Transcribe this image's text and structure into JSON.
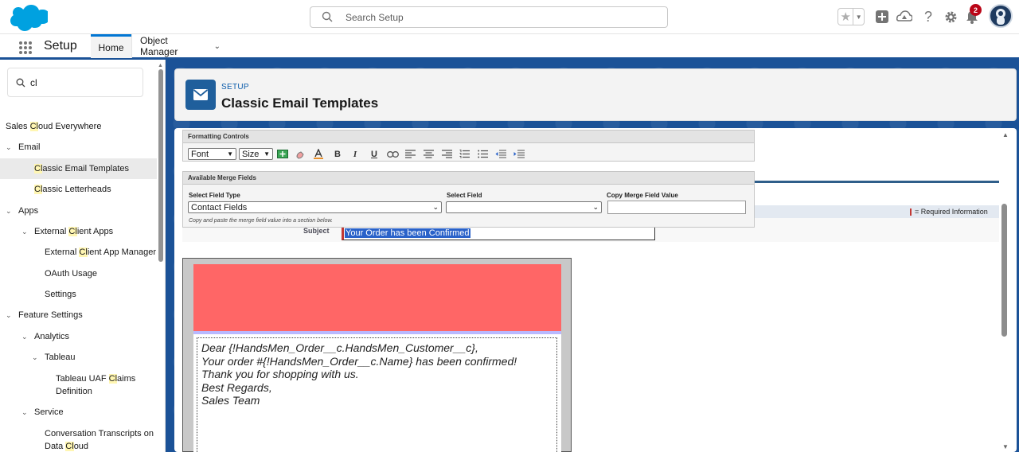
{
  "header": {
    "search_placeholder": "Search Setup",
    "notification_count": "2"
  },
  "appnav": {
    "app_name": "Setup",
    "tabs": [
      {
        "label": "Home"
      },
      {
        "label": "Object Manager"
      }
    ]
  },
  "sidebar": {
    "quick_find_value": "cl",
    "items": [
      {
        "pre": "Sales ",
        "hl": "Cl",
        "post": "oud Everywhere"
      },
      {
        "pre": "Email",
        "hl": "",
        "post": ""
      },
      {
        "pre": "",
        "hl": "Cl",
        "post": "assic Email Templates"
      },
      {
        "pre": "",
        "hl": "Cl",
        "post": "assic Letterheads"
      },
      {
        "pre": "Apps",
        "hl": "",
        "post": ""
      },
      {
        "pre": "External ",
        "hl": "Cl",
        "post": "ient Apps"
      },
      {
        "pre": "External ",
        "hl": "Cl",
        "post": "ient App Manager"
      },
      {
        "pre": "OAuth Usage",
        "hl": "",
        "post": ""
      },
      {
        "pre": "Settings",
        "hl": "",
        "post": ""
      },
      {
        "pre": "Feature Settings",
        "hl": "",
        "post": ""
      },
      {
        "pre": "Analytics",
        "hl": "",
        "post": ""
      },
      {
        "pre": "Tableau",
        "hl": "",
        "post": ""
      },
      {
        "pre": "Tableau UAF ",
        "hl": "Cl",
        "post": "aims"
      },
      {
        "pre": "Definition",
        "hl": "",
        "post": ""
      },
      {
        "pre": "Service",
        "hl": "",
        "post": ""
      },
      {
        "pre": "Conversation Transcripts on",
        "hl": "",
        "post": ""
      },
      {
        "pre": "Data ",
        "hl": "Cl",
        "post": "oud"
      }
    ]
  },
  "page_header": {
    "eyebrow": "SETUP",
    "title": "Classic Email Templates"
  },
  "formatting": {
    "title": "Formatting Controls",
    "font_label": "Font",
    "size_label": "Size",
    "buttons": [
      "B",
      "I",
      "U"
    ]
  },
  "merge": {
    "title": "Available Merge Fields",
    "field_type_label": "Select Field Type",
    "field_type_value": "Contact Fields",
    "field_label": "Select Field",
    "field_value": "",
    "copy_label": "Copy Merge Field Value",
    "copy_value": "",
    "hint": "Copy and paste the merge field value into a section below."
  },
  "form": {
    "required_info": "= Required Information",
    "subject_label": "Subject",
    "subject_value": "Your Order has been Confirmed"
  },
  "email_body": {
    "lines": [
      "Dear {!HandsMen_Order__c.HandsMen_Customer__c},",
      "Your order #{!HandsMen_Order__c.Name} has been confirmed!",
      "Thank you for shopping with us.",
      "Best Regards,",
      "Sales Team"
    ]
  },
  "colors": {
    "brand_blue": "#1b5297",
    "letterhead_red": "#ff6666",
    "selection_blue": "#2a62c9"
  }
}
